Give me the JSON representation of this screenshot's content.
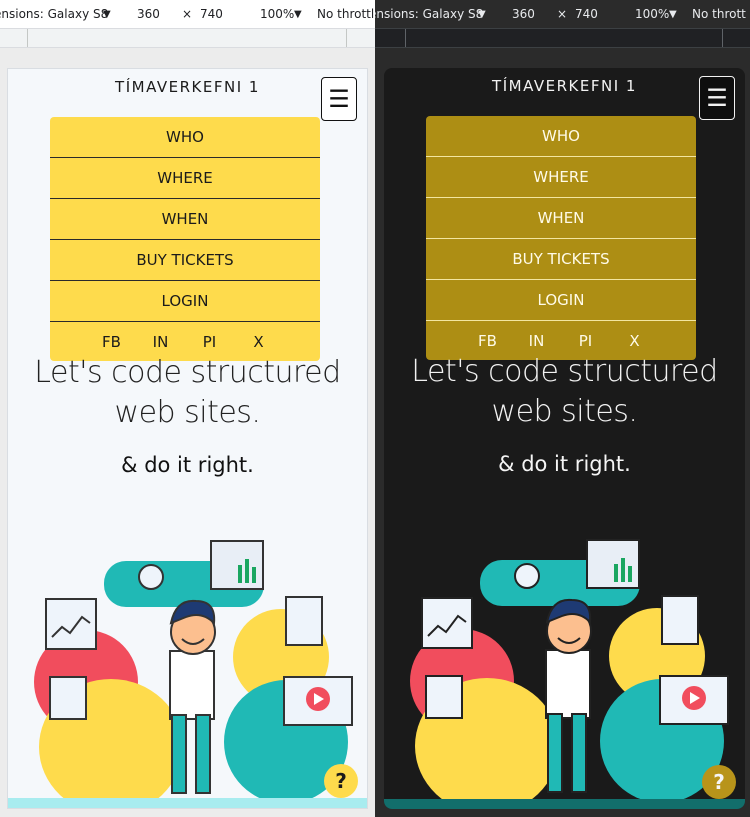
{
  "devtools": {
    "dimensions_label": "ensions: Galaxy S8",
    "width": "360",
    "height": "740",
    "times": "×",
    "zoom": "100%",
    "throttle_left": "No throttli",
    "throttle_right": "No thrott"
  },
  "site": {
    "title": "TÍMAVERKEFNI 1",
    "hamburger_glyph": "☰",
    "help_glyph": "?",
    "hero_line1": "Let's code structured",
    "hero_line2": "web sites.",
    "subhero": "& do it right."
  },
  "menu": {
    "items": [
      "WHO",
      "WHERE",
      "WHEN",
      "BUY TICKETS",
      "LOGIN"
    ],
    "social": [
      "FB",
      "IN",
      "PI",
      "X"
    ]
  },
  "colors": {
    "accent_light": "#fedb4c",
    "accent_dark": "#ad8e14",
    "teal": "#20b9b5",
    "coral": "#f14d5d"
  }
}
